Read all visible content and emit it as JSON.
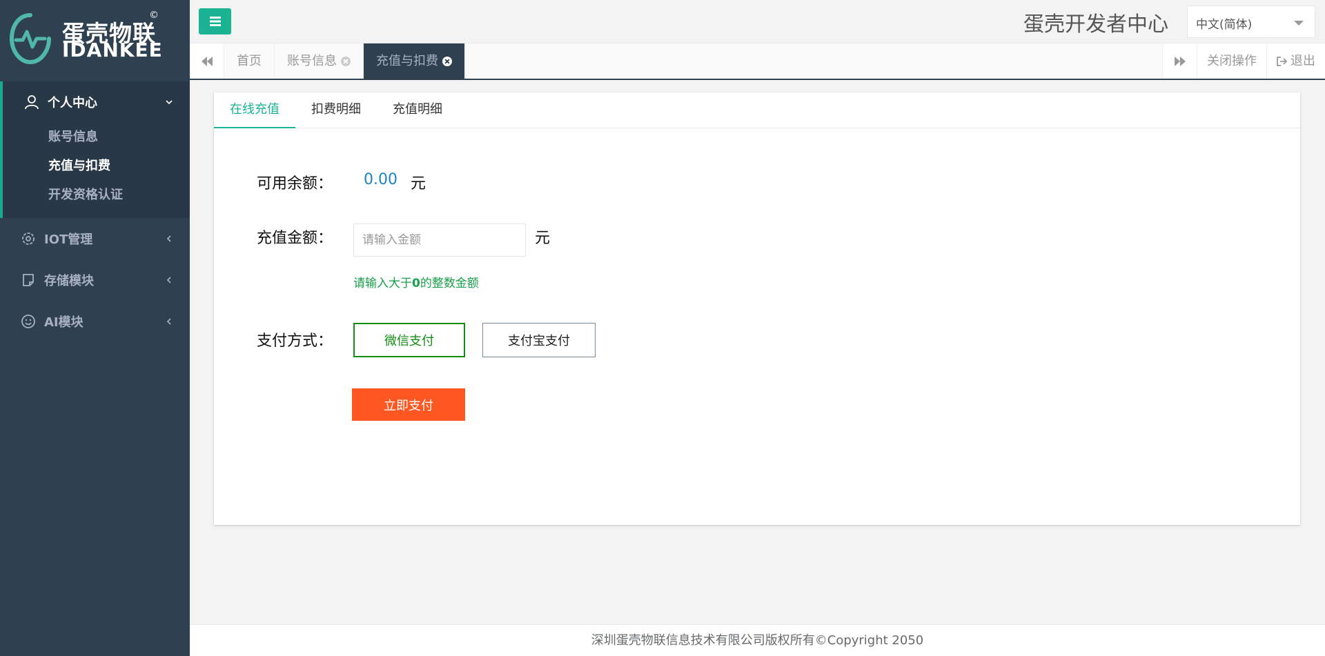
{
  "brand": {
    "name_cn": "蛋壳物联",
    "name_en": "IDANKEE",
    "copyright_mark": "©",
    "accent_color": "#1ab394"
  },
  "sidebar": {
    "groups": [
      {
        "label": "个人中心",
        "icon": "user-icon",
        "expanded": true,
        "items": [
          {
            "label": "账号信息",
            "active": false
          },
          {
            "label": "充值与扣费",
            "active": true
          },
          {
            "label": "开发资格认证",
            "active": false
          }
        ]
      },
      {
        "label": "IOT管理",
        "icon": "iot-gear-icon",
        "expanded": false
      },
      {
        "label": "存储模块",
        "icon": "note-icon",
        "expanded": false
      },
      {
        "label": "AI模块",
        "icon": "smile-icon",
        "expanded": false
      }
    ]
  },
  "header": {
    "title": "蛋壳开发者中心",
    "language": "中文(简体)"
  },
  "tabbar": {
    "tabs": [
      {
        "label": "首页",
        "closable": false,
        "active": false
      },
      {
        "label": "账号信息",
        "closable": true,
        "active": false
      },
      {
        "label": "充值与扣费",
        "closable": true,
        "active": true
      }
    ],
    "close_ops_label": "关闭操作",
    "logout_label": "退出"
  },
  "card": {
    "tabs": [
      {
        "label": "在线充值",
        "active": true
      },
      {
        "label": "扣费明细",
        "active": false
      },
      {
        "label": "充值明细",
        "active": false
      }
    ],
    "balance_label": "可用余额：",
    "balance_value": "0.00",
    "currency": "元",
    "amount_label": "充值金额：",
    "amount_placeholder": "请输入金额",
    "amount_hint_pre": "请输入大于",
    "amount_hint_num": "0",
    "amount_hint_post": "的整数金额",
    "pay_method_label": "支付方式：",
    "pay_wechat": "微信支付",
    "pay_alipay": "支付宝支付",
    "submit_label": "立即支付"
  },
  "footer": {
    "text": "深圳蛋壳物联信息技术有限公司版权所有©Copyright 2050"
  }
}
